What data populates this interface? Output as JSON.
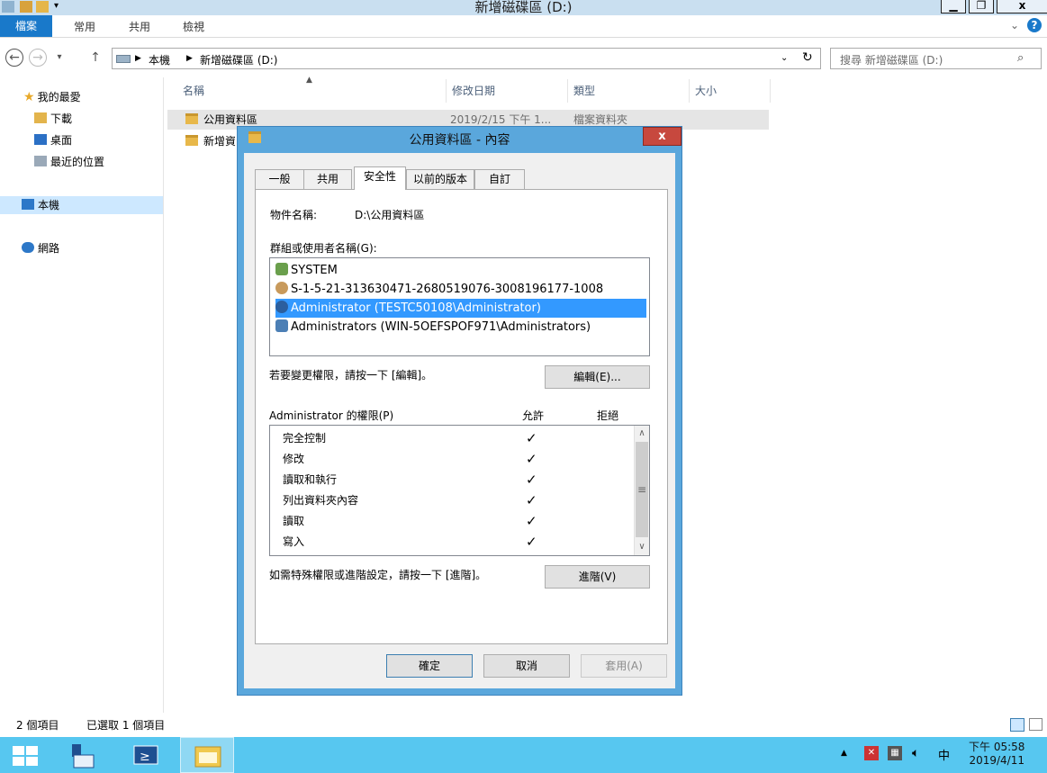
{
  "window": {
    "title": "新增磁碟區 (D:)"
  },
  "ribbon": {
    "tabs": [
      "檔案",
      "常用",
      "共用",
      "檢視"
    ]
  },
  "address": {
    "crumbs": [
      "本機",
      "新增磁碟區 (D:)"
    ],
    "search_placeholder": "搜尋 新增磁碟區 (D:)"
  },
  "nav": {
    "favorites": "我的最愛",
    "favorites_items": [
      "下載",
      "桌面",
      "最近的位置"
    ],
    "this_pc": "本機",
    "network": "網路"
  },
  "filelist": {
    "columns": [
      "名稱",
      "修改日期",
      "類型",
      "大小"
    ],
    "rows": [
      {
        "name": "公用資料區",
        "date": "2019/2/15 下午 1...",
        "type": "檔案資料夾",
        "size": ""
      },
      {
        "name": "新增資",
        "date": "",
        "type": "",
        "size": ""
      }
    ]
  },
  "status": {
    "count": "2 個項目",
    "selected": "已選取 1 個項目"
  },
  "dialog": {
    "title": "公用資料區 - 內容",
    "tabs": [
      "一般",
      "共用",
      "安全性",
      "以前的版本",
      "自訂"
    ],
    "object_label": "物件名稱:",
    "object_value": "D:\\公用資料區",
    "group_label": "群組或使用者名稱(G):",
    "groups": [
      "SYSTEM",
      "S-1-5-21-313630471-2680519076-3008196177-1008",
      "Administrator (TESTC50108\\Administrator)",
      "Administrators (WIN-5OEFSPOF971\\Administrators)"
    ],
    "change_hint": "若要變更權限，請按一下 [編輯]。",
    "edit_button": "編輯(E)...",
    "perm_label": "Administrator 的權限(P)",
    "allow_header": "允許",
    "deny_header": "拒絕",
    "permissions": [
      {
        "name": "完全控制",
        "allow": "✓"
      },
      {
        "name": "修改",
        "allow": "✓"
      },
      {
        "name": "讀取和執行",
        "allow": "✓"
      },
      {
        "name": "列出資料夾內容",
        "allow": "✓"
      },
      {
        "name": "讀取",
        "allow": "✓"
      },
      {
        "name": "寫入",
        "allow": "✓"
      }
    ],
    "advanced_hint": "如需特殊權限或進階設定，請按一下 [進階]。",
    "advanced_button": "進階(V)",
    "ok_button": "確定",
    "cancel_button": "取消",
    "apply_button": "套用(A)",
    "close_glyph": "x"
  },
  "taskbar": {
    "time": "下午 05:58",
    "date": "2019/4/11",
    "ime": "中"
  },
  "colors": {
    "accent": "#1979ca",
    "taskbar": "#57c7f0",
    "dialog_frame": "#5aa7dc",
    "selection": "#3399ff",
    "close": "#c7483e"
  }
}
